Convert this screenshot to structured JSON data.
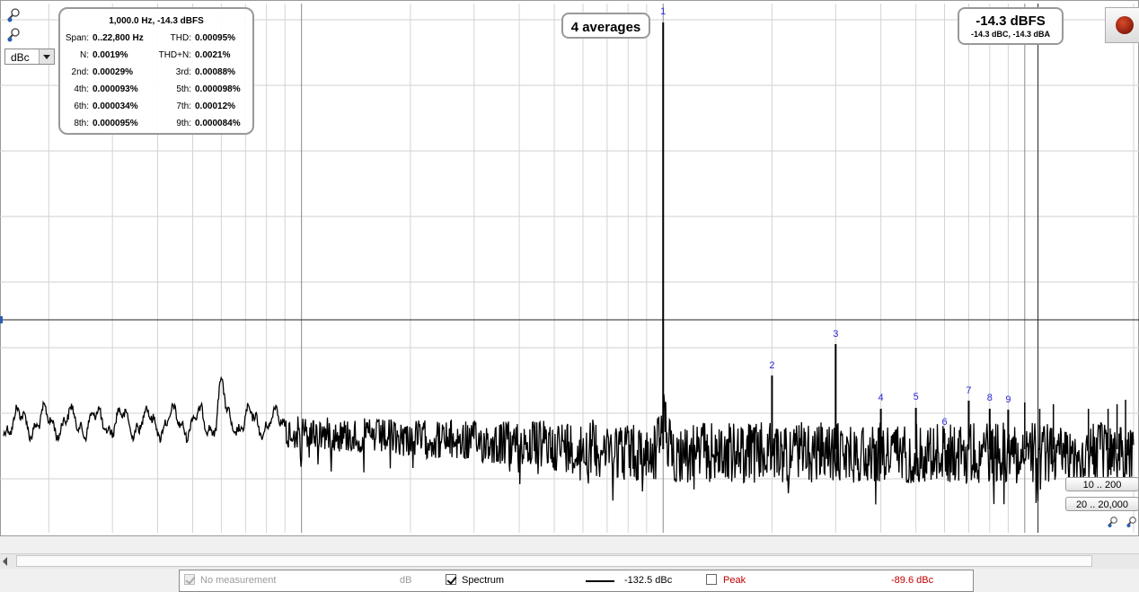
{
  "chart_data": {
    "type": "line",
    "xscale": "log",
    "xlim": [
      15,
      20000
    ],
    "x_ticks": [
      "15",
      "20",
      "30",
      "40",
      "50",
      "60",
      "70",
      "80",
      "100",
      "200",
      "300",
      "400",
      "500",
      "600",
      "700",
      "900",
      "1k",
      "2k",
      "3k",
      "4k",
      "5k",
      "6k",
      "7k",
      "8k",
      "9k",
      "20"
    ],
    "x_tick_values": [
      15,
      20,
      30,
      40,
      50,
      60,
      70,
      80,
      100,
      200,
      300,
      400,
      500,
      600,
      700,
      900,
      1000,
      2000,
      3000,
      4000,
      5000,
      6000,
      7000,
      8000,
      9000,
      20000
    ],
    "cursor_x_label": "10.88k",
    "cursor_x": 10880,
    "fundamental_hz": 1000,
    "harmonics": [
      {
        "label": "1",
        "hz": 1000
      },
      {
        "label": "2",
        "hz": 2000
      },
      {
        "label": "3",
        "hz": 3000
      },
      {
        "label": "4",
        "hz": 4000
      },
      {
        "label": "5",
        "hz": 5000
      },
      {
        "label": "6",
        "hz": 6000
      },
      {
        "label": "7",
        "hz": 7000
      },
      {
        "label": "8",
        "hz": 8000
      },
      {
        "label": "9",
        "hz": 9000
      }
    ],
    "extra_spurs_hz": [
      10000,
      11000,
      12000,
      15000,
      17000,
      18000,
      19000
    ],
    "series": [
      {
        "values_note": "",
        "color": "#000000"
      }
    ]
  },
  "info": {
    "header": "1,000.0 Hz, -14.3 dBFS",
    "rows": [
      {
        "l1": "Span:",
        "v1": "0..22,800 Hz",
        "l2": "THD:",
        "v2": "0.00095%"
      },
      {
        "l1": "N:",
        "v1": "0.0019%",
        "l2": "THD+N:",
        "v2": "0.0021%"
      },
      {
        "l1": "2nd:",
        "v1": "0.00029%",
        "l2": "3rd:",
        "v2": "0.00088%"
      },
      {
        "l1": "4th:",
        "v1": "0.000093%",
        "l2": "5th:",
        "v2": "0.000098%"
      },
      {
        "l1": "6th:",
        "v1": "0.000034%",
        "l2": "7th:",
        "v2": "0.00012%"
      },
      {
        "l1": "8th:",
        "v1": "0.000095%",
        "l2": "9th:",
        "v2": "0.000084%"
      }
    ]
  },
  "averages_label": "4 averages",
  "level": {
    "main": "-14.3 dBFS",
    "sub": "-14.3 dBC, -14.3 dBA"
  },
  "weighting": "dBc",
  "range_buttons": [
    "10 .. 200",
    "20 .. 20,000"
  ],
  "legend": {
    "no_measurement": "No measurement",
    "no_measurement_unit": "dB",
    "spectrum": "Spectrum",
    "spectrum_value": "-132.5 dBc",
    "peak": "Peak",
    "peak_value": "-89.6 dBc",
    "spectrum_checked": true,
    "peak_checked": false,
    "peak_color": "#c00000"
  }
}
